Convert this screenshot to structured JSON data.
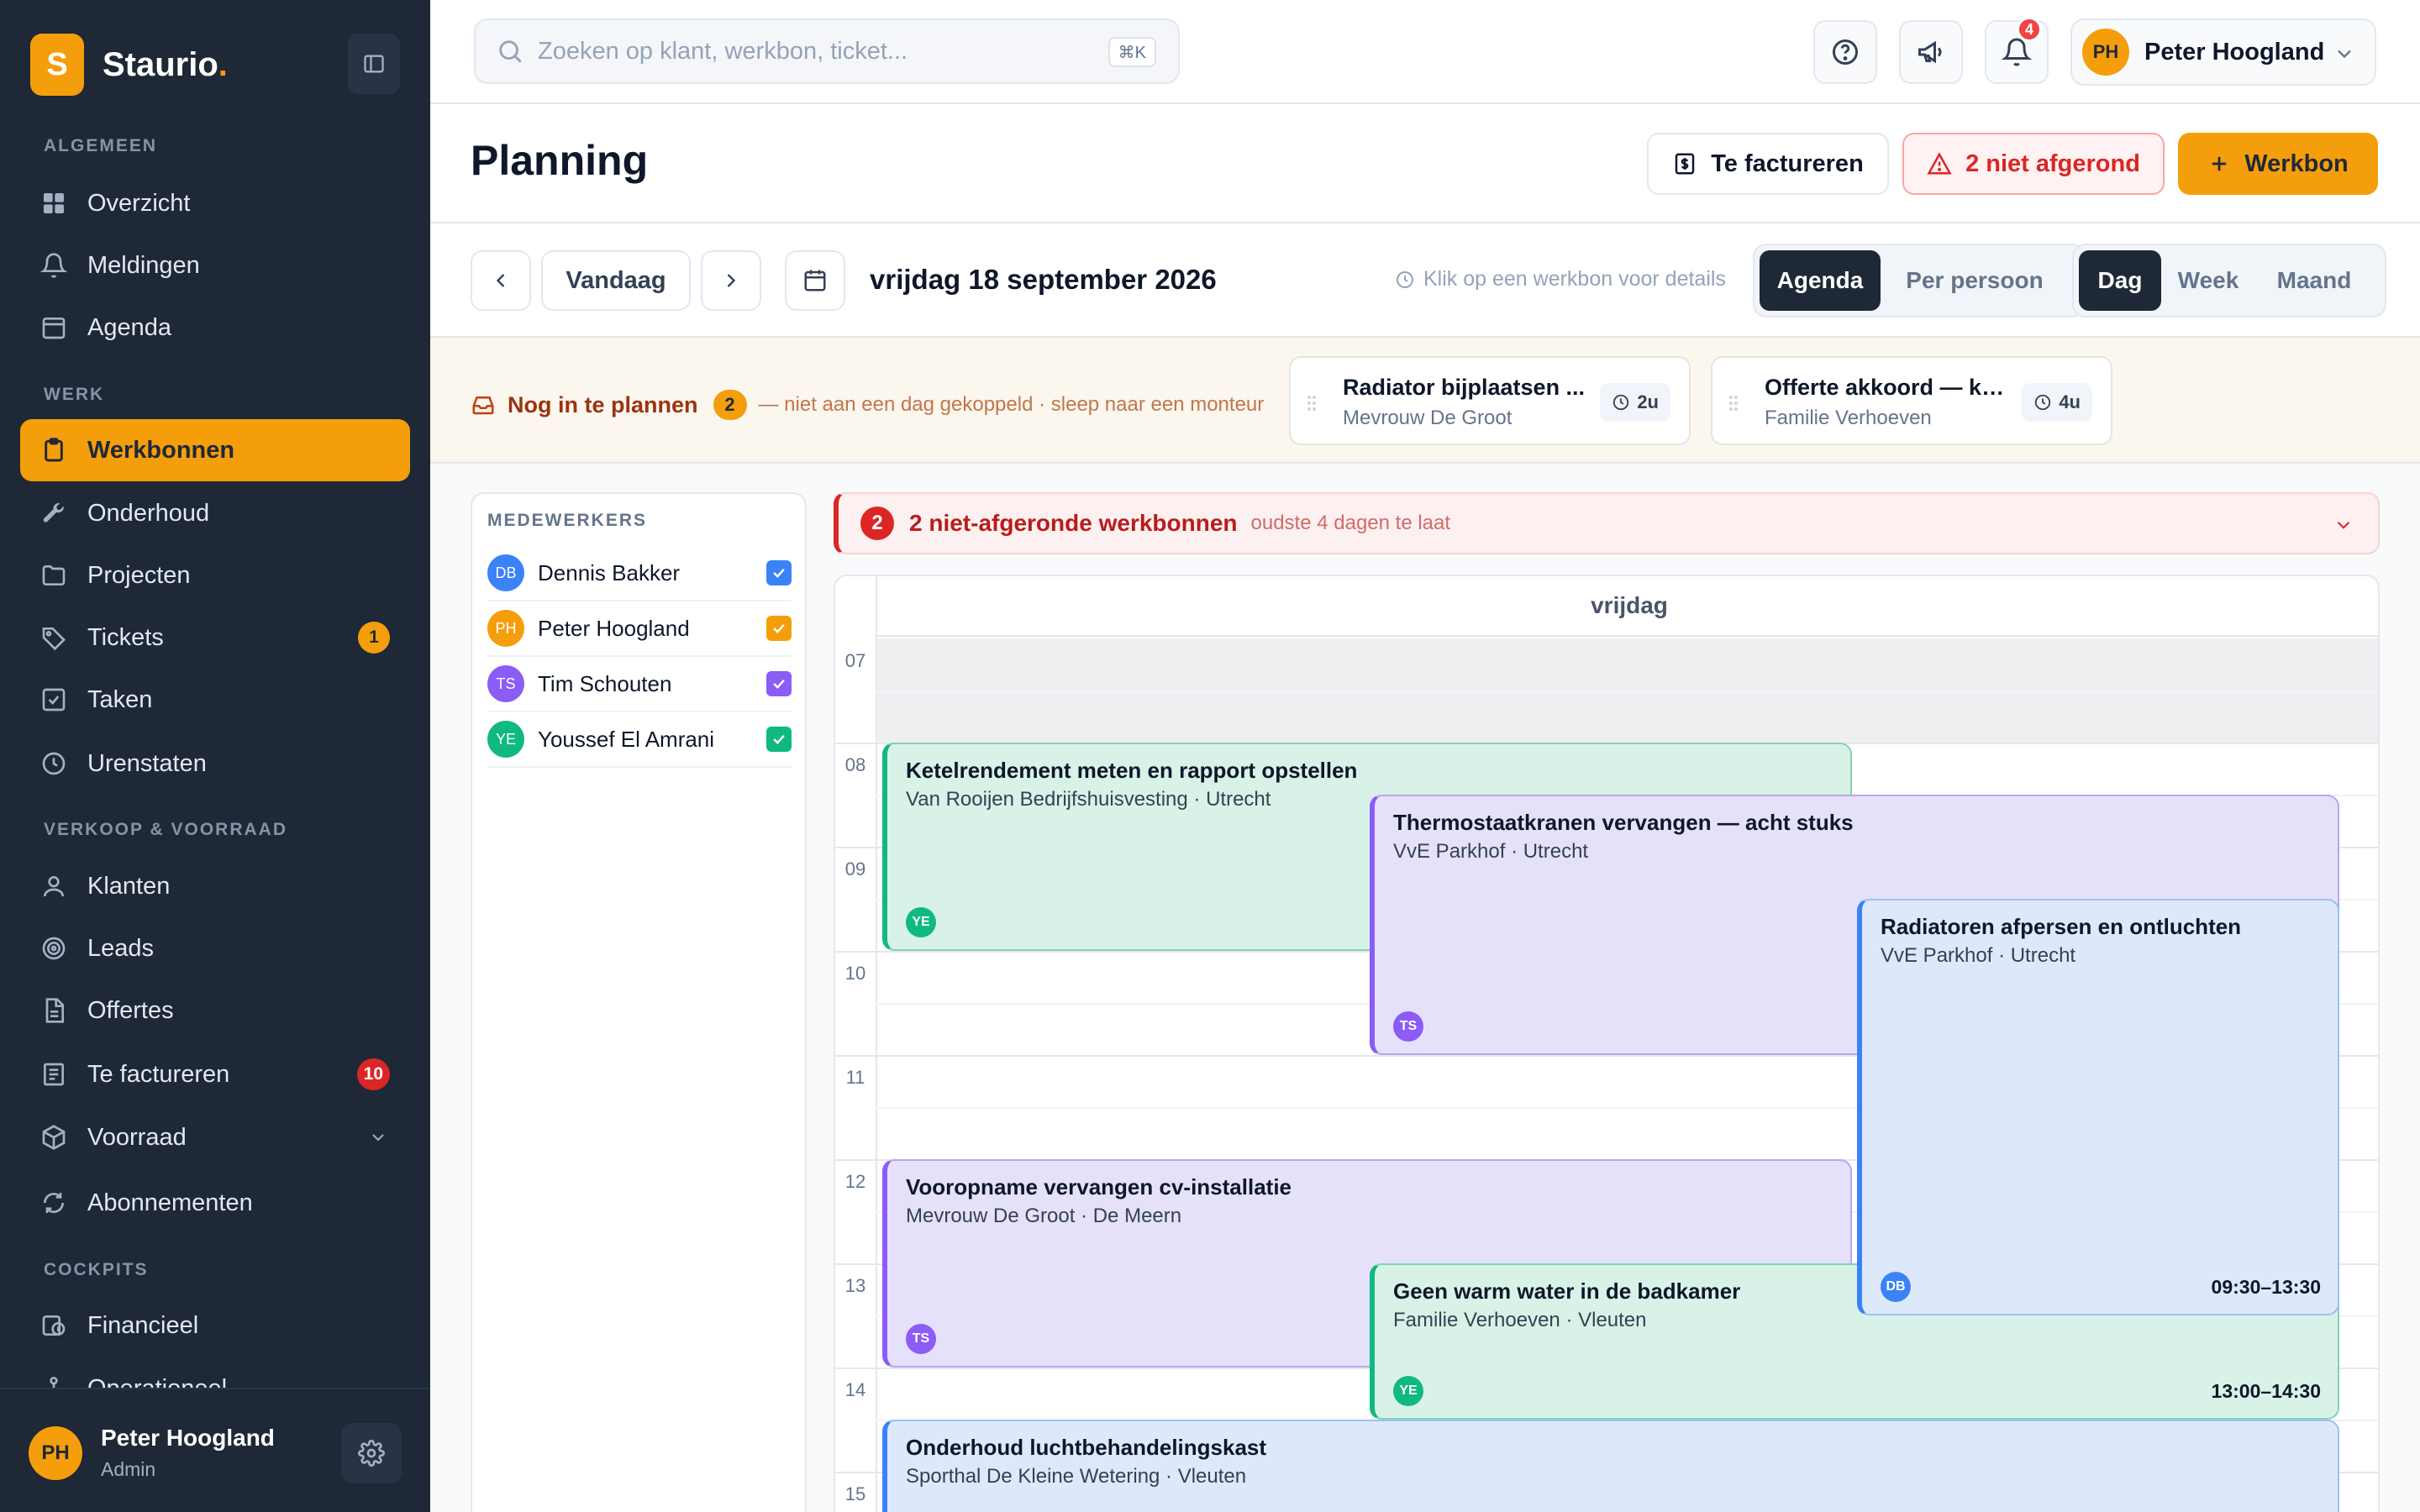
{
  "brand": {
    "letter": "S",
    "name": "Staurio",
    "dot": "."
  },
  "sidebar": {
    "sections": [
      "ALGEMEEN",
      "WERK",
      "VERKOOP & VOORRAAD",
      "COCKPITS"
    ],
    "items": [
      {
        "label": "Overzicht",
        "icon": "dashboard-icon"
      },
      {
        "label": "Meldingen",
        "icon": "bell-icon"
      },
      {
        "label": "Agenda",
        "icon": "calendar-icon"
      },
      {
        "label": "Werkbonnen",
        "icon": "clipboard-icon",
        "active": true
      },
      {
        "label": "Onderhoud",
        "icon": "wrench-icon"
      },
      {
        "label": "Projecten",
        "icon": "folder-icon"
      },
      {
        "label": "Tickets",
        "icon": "tag-icon",
        "badge": "1"
      },
      {
        "label": "Taken",
        "icon": "checkbox-icon"
      },
      {
        "label": "Urenstaten",
        "icon": "clock-icon"
      },
      {
        "label": "Klanten",
        "icon": "user-icon"
      },
      {
        "label": "Leads",
        "icon": "target-icon"
      },
      {
        "label": "Offertes",
        "icon": "document-icon"
      },
      {
        "label": "Te factureren",
        "icon": "receipt-icon",
        "badge": "10"
      },
      {
        "label": "Voorraad",
        "icon": "box-icon"
      },
      {
        "label": "Abonnementen",
        "icon": "refresh-icon"
      },
      {
        "label": "Financieel",
        "icon": "finance-icon"
      },
      {
        "label": "Operationeel",
        "icon": "operations-icon"
      }
    ],
    "user": {
      "initials": "PH",
      "name": "Peter Hoogland",
      "role": "Admin"
    }
  },
  "topbar": {
    "search_placeholder": "Zoeken op klant, werkbon, ticket...",
    "shortcut": "⌘K",
    "notifications_count": "4",
    "user": {
      "initials": "PH",
      "name": "Peter Hoogland"
    }
  },
  "header": {
    "title": "Planning",
    "btn_invoice": "Te factureren",
    "btn_unfinished": "2 niet afgerond",
    "btn_new": "Werkbon"
  },
  "toolbar": {
    "today": "Vandaag",
    "date": "vrijdag 18 september 2026",
    "hint": "Klik op een werkbon voor details",
    "view_tabs": [
      "Agenda",
      "Per persoon"
    ],
    "range_tabs": [
      "Dag",
      "Week",
      "Maand"
    ]
  },
  "unplanned": {
    "title": "Nog in te plannen",
    "count": "2",
    "subtitle": "— niet aan een dag gekoppeld · sleep naar een monteur",
    "cards": [
      {
        "title": "Radiator bijplaatsen ...",
        "customer": "Mevrouw De Groot",
        "duration": "2u"
      },
      {
        "title": "Offerte akkoord — ke...",
        "customer": "Familie Verhoeven",
        "duration": "4u"
      }
    ]
  },
  "employees": {
    "label": "MEDEWERKERS",
    "list": [
      {
        "initials": "DB",
        "name": "Dennis Bakker",
        "color": "#3b82f6"
      },
      {
        "initials": "PH",
        "name": "Peter Hoogland",
        "color": "#f59e0b"
      },
      {
        "initials": "TS",
        "name": "Tim Schouten",
        "color": "#8b5cf6"
      },
      {
        "initials": "YE",
        "name": "Youssef El Amrani",
        "color": "#10b981"
      }
    ]
  },
  "alert": {
    "count": "2",
    "title": "2 niet-afgeronde werkbonnen",
    "subtitle": "oudste 4 dagen te laat"
  },
  "calendar": {
    "day": "vrijdag",
    "hours": [
      "07",
      "08",
      "09",
      "10",
      "11",
      "12",
      "13",
      "14",
      "15"
    ],
    "events": [
      {
        "title": "Ketelrendement meten en rapport opstellen",
        "subtitle": "Van Rooijen Bedrijfshuisvesting · Utrecht",
        "initials": "YE",
        "color": "green",
        "time": ""
      },
      {
        "title": "Thermostaatkranen vervangen — acht stuks",
        "subtitle": "VvE Parkhof · Utrecht",
        "initials": "TS",
        "color": "purple",
        "time": ""
      },
      {
        "title": "Radiatoren afpersen en ontluchten",
        "subtitle": "VvE Parkhof · Utrecht",
        "initials": "DB",
        "color": "blue",
        "time": "09:30–13:30"
      },
      {
        "title": "Vooropname vervangen cv-installatie",
        "subtitle": "Mevrouw De Groot · De Meern",
        "initials": "TS",
        "color": "purple",
        "time": ""
      },
      {
        "title": "Geen warm water in de badkamer",
        "subtitle": "Familie Verhoeven · Vleuten",
        "initials": "YE",
        "color": "green",
        "time": "13:00–14:30"
      },
      {
        "title": "Onderhoud luchtbehandelingskast",
        "subtitle": "Sporthal De Kleine Wetering · Vleuten",
        "initials": "",
        "color": "blue",
        "time": ""
      }
    ]
  },
  "colors": {
    "accent": "#f59e0b",
    "sidebar_bg": "#1e2836",
    "danger": "#dc2626",
    "green_initials": "#10b981",
    "purple_initials": "#8b5cf6",
    "blue_initials": "#3b82f6"
  }
}
